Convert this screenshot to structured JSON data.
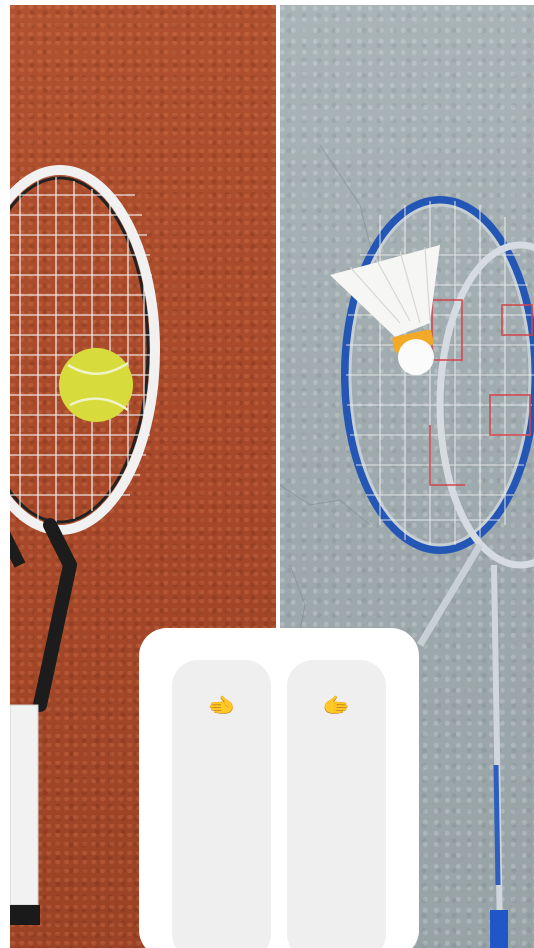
{
  "panels": {
    "left": {
      "subject": "tennis-racket-with-ball-on-clay-court"
    },
    "right": {
      "subject": "badminton-rackets-with-shuttlecock-on-concrete"
    }
  },
  "choice_card": {
    "left_option": {
      "icon": "pointing-left-hand-icon",
      "emoji": "🫲"
    },
    "right_option": {
      "icon": "pointing-right-hand-icon",
      "emoji": "🫱"
    }
  },
  "colors": {
    "clay": "#a8492a",
    "concrete": "#9ea9ad",
    "tennis_ball": "#d7dc3c",
    "badminton_frame": "#2457b5",
    "card": "#ffffff",
    "option_bg": "#efefef"
  }
}
